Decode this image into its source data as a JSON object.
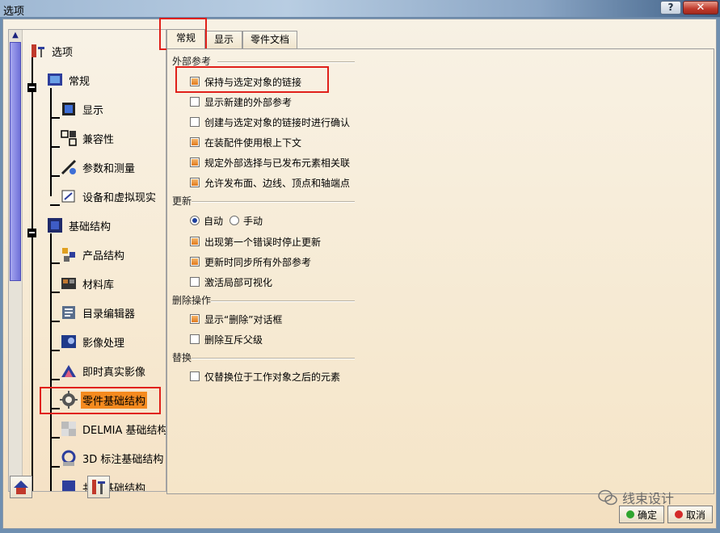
{
  "window": {
    "title": "选项",
    "help_label": "?",
    "close_label": "✕"
  },
  "tree": {
    "root": "选项",
    "items": [
      {
        "label": "常规",
        "icon": "general-icon"
      },
      {
        "label": "显示",
        "icon": "display-icon"
      },
      {
        "label": "兼容性",
        "icon": "compatibility-icon"
      },
      {
        "label": "参数和测量",
        "icon": "parameters-icon"
      },
      {
        "label": "设备和虚拟现实",
        "icon": "devices-icon"
      },
      {
        "label": "基础结构",
        "icon": "infrastructure-icon"
      },
      {
        "label": "产品结构",
        "icon": "product-structure-icon"
      },
      {
        "label": "材料库",
        "icon": "material-library-icon"
      },
      {
        "label": "目录编辑器",
        "icon": "catalog-editor-icon"
      },
      {
        "label": "影像处理",
        "icon": "image-processing-icon"
      },
      {
        "label": "即时真实影像",
        "icon": "realtime-image-icon"
      },
      {
        "label": "零件基础结构",
        "icon": "part-infrastructure-icon"
      },
      {
        "label": "DELMIA 基础结构",
        "icon": "delmia-icon"
      },
      {
        "label": "3D 标注基础结构",
        "icon": "3d-annotation-icon"
      },
      {
        "label": "共享基础结构",
        "icon": "shared-infrastructure-icon"
      }
    ]
  },
  "tabs": [
    {
      "label": "常规"
    },
    {
      "label": "显示"
    },
    {
      "label": "零件文档"
    }
  ],
  "groups": {
    "external": {
      "title": "外部参考",
      "options": [
        {
          "label": "保持与选定对象的链接",
          "checked": true
        },
        {
          "label": "显示新建的外部参考",
          "checked": false
        },
        {
          "label": "创建与选定对象的链接时进行确认",
          "checked": false
        },
        {
          "label": "在装配件使用根上下文",
          "checked": true
        },
        {
          "label": "规定外部选择与已发布元素相关联",
          "checked": true
        },
        {
          "label": "允许发布面、边线、顶点和轴端点",
          "checked": true
        }
      ]
    },
    "update": {
      "title": "更新",
      "radio_auto": "自动",
      "radio_manual": "手动",
      "options": [
        {
          "label": "出现第一个错误时停止更新",
          "checked": true
        },
        {
          "label": "更新时同步所有外部参考",
          "checked": true
        },
        {
          "label": "激活局部可视化",
          "checked": false
        }
      ]
    },
    "delete": {
      "title": "删除操作",
      "options": [
        {
          "label": "显示“删除”对话框",
          "checked": true
        },
        {
          "label": "删除互斥父级",
          "checked": false
        }
      ]
    },
    "replace": {
      "title": "替换",
      "options": [
        {
          "label": "仅替换位于工作对象之后的元素",
          "checked": false
        }
      ]
    }
  },
  "buttons": {
    "ok": "确定",
    "cancel": "取消"
  },
  "watermark": "线束设计",
  "colors": {
    "selected": "#f58a1f",
    "highlight": "#e0201a",
    "ok_dot": "#2fa52f",
    "cancel_dot": "#d42a2a"
  }
}
